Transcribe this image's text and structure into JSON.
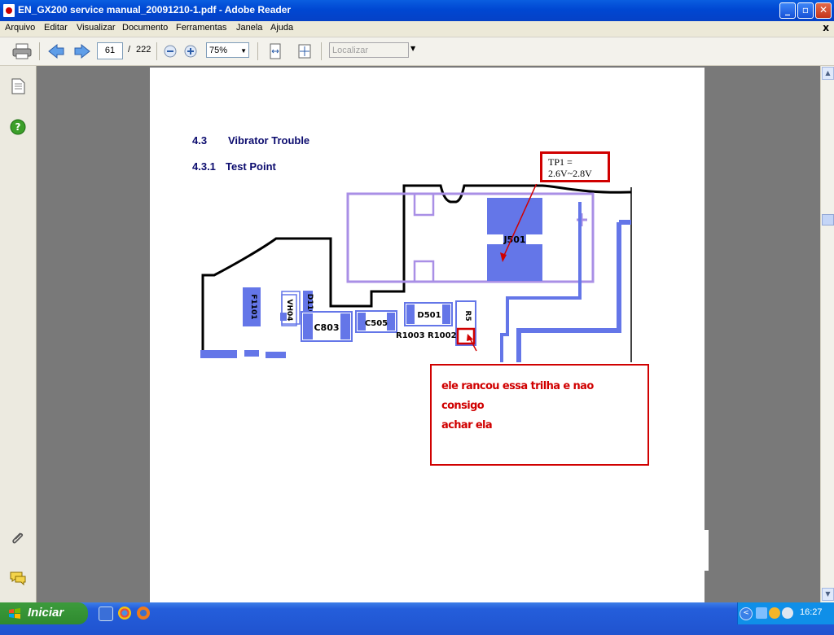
{
  "window": {
    "title": "EN_GX200 service manual_20091210-1.pdf - Adobe Reader",
    "controls": {
      "minimize": "_",
      "maximize": "▫",
      "close": "✕"
    }
  },
  "menu": {
    "items": [
      "Arquivo",
      "Editar",
      "Visualizar",
      "Documento",
      "Ferramentas",
      "Janela",
      "Ajuda"
    ],
    "close_glyph": "x"
  },
  "toolbar": {
    "current_page": "61",
    "page_separator": "/",
    "total_pages": "222",
    "zoom": "75%",
    "search_placeholder": "Localizar"
  },
  "document": {
    "section": {
      "number": "4.3",
      "title": "Vibrator Trouble"
    },
    "subsection": {
      "number": "4.3.1",
      "title": "Test Point"
    },
    "tp_label": {
      "line1": "TP1 =",
      "line2": "2.6V~2.8V"
    },
    "note": {
      "line1": "ele rancou essa trilha e nao consigo",
      "line2": "achar ela"
    },
    "pcb_labels": [
      "J501",
      "F1101",
      "VH04",
      "D1102",
      "C803",
      "C505",
      "D501",
      "R1003",
      "R1002",
      "R5"
    ]
  },
  "taskbar": {
    "start_label": "Iniciar",
    "clock": "16:27"
  },
  "colors": {
    "title_bar": "#0047d2",
    "heading_navy": "#0b0b6e",
    "annotation_red": "#d00000",
    "pcb_pad_blue": "#6476e8",
    "pcb_outline_violet": "#a98fe6",
    "taskbar_blue": "#245edb",
    "start_green": "#3c9b3c"
  }
}
